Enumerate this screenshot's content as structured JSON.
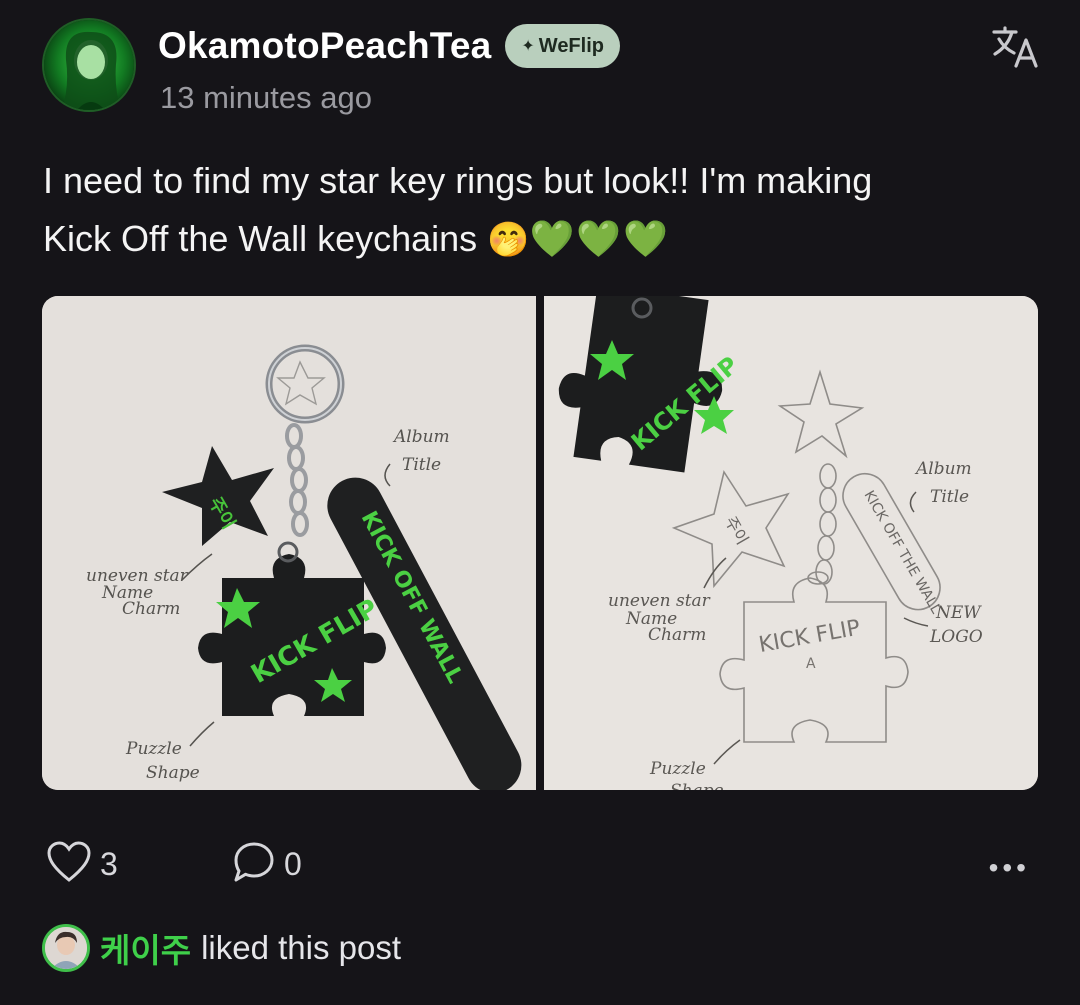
{
  "author": {
    "name": "OkamotoPeachTea",
    "badge": "WeFlip",
    "badge_icon": "sparkle-icon",
    "timestamp": "13 minutes ago"
  },
  "post": {
    "text_line1": "I need to find my star key rings but look!! I'm making",
    "text_line2": "Kick Off the Wall keychains",
    "emoji": "🤭",
    "hearts": "💚💚💚"
  },
  "images": {
    "left": {
      "labels": {
        "album": "Album",
        "title": "Title",
        "uneven": "uneven star",
        "name": "Name",
        "charm": "Charm",
        "puzzle": "Puzzle",
        "shape": "Shape",
        "star_text": "주이",
        "bar_text": "KICK OFF WALL",
        "puzzle_text": "KICK FLIP"
      }
    },
    "right": {
      "labels": {
        "album": "Album",
        "title": "Title",
        "uneven": "uneven star",
        "name": "Name",
        "charm": "Charm",
        "new": "NEW",
        "logo": "LOGO",
        "puzzle": "Puzzle",
        "shape": "Shape",
        "star_text": "주이",
        "bar_text": "KICK OFF THE WALL",
        "puzzle_text": "KICK FLIP",
        "puzzle_a": "A",
        "sketch_flip": "KICK FLIP"
      }
    }
  },
  "actions": {
    "like_count": "3",
    "comment_count": "0",
    "more": "•••"
  },
  "liked_by": {
    "name": "케이주",
    "text": "liked this post"
  },
  "colors": {
    "background": "#151418",
    "accent_green": "#3fd04a",
    "badge_bg": "#b9cfbd",
    "muted": "#9a9aa0"
  }
}
